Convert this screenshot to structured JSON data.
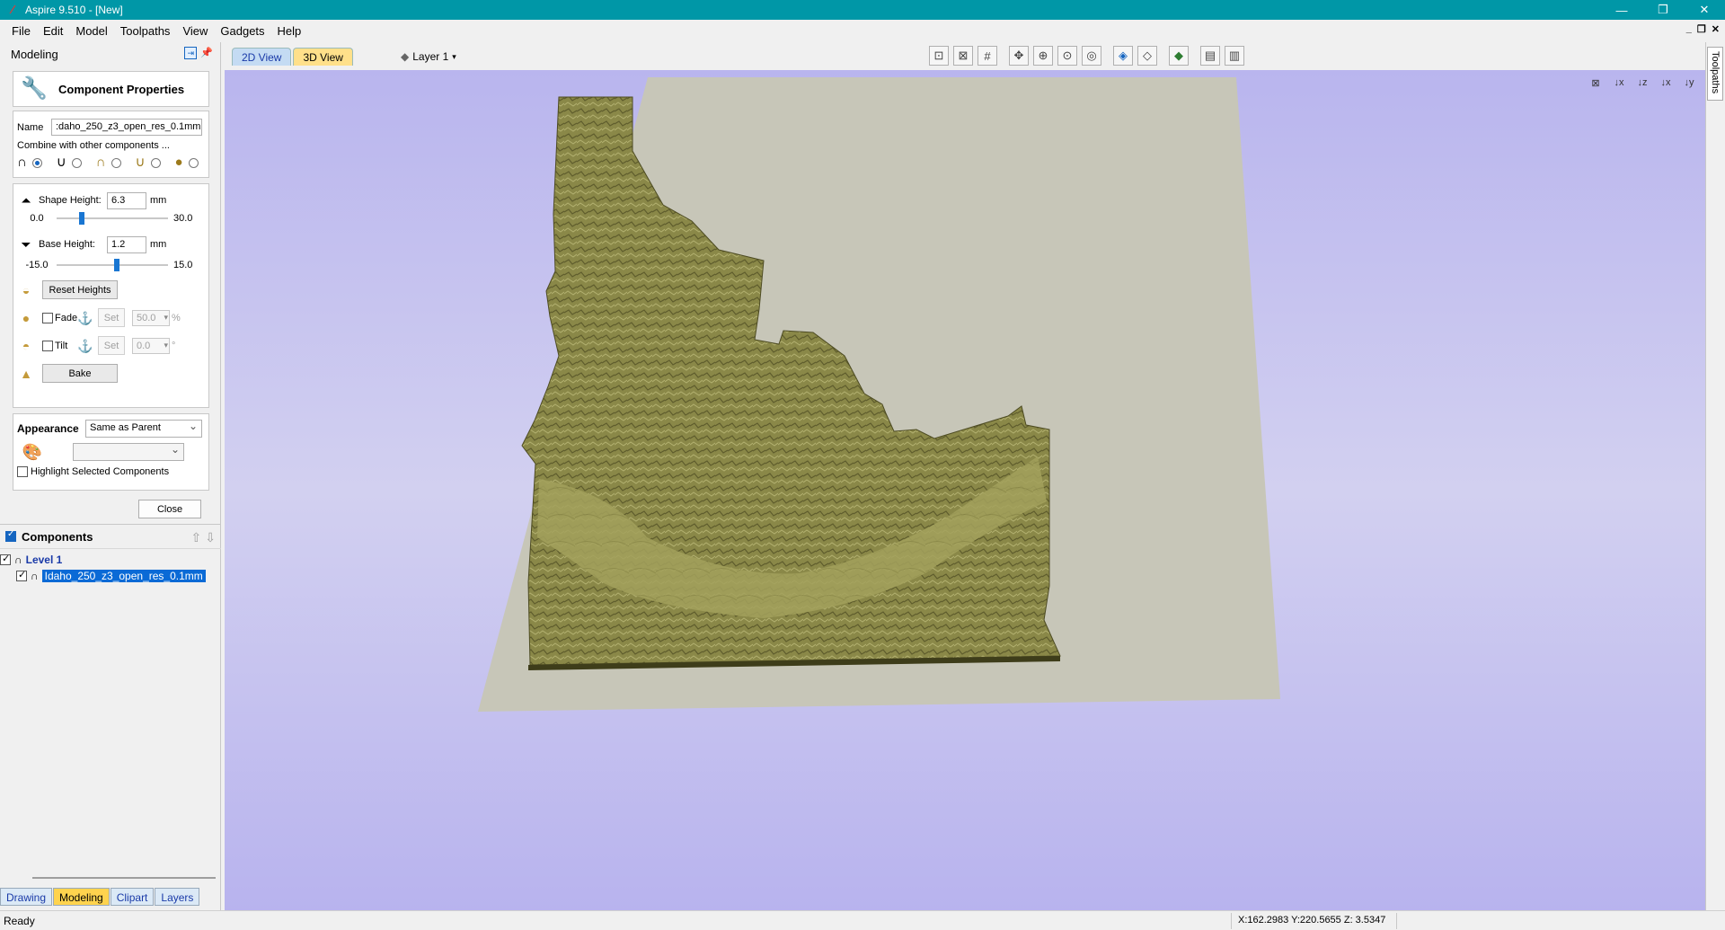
{
  "window": {
    "title": "Aspire 9.510 - [New]"
  },
  "menu": [
    "File",
    "Edit",
    "Model",
    "Toolpaths",
    "View",
    "Gadgets",
    "Help"
  ],
  "panel": {
    "title": "Modeling",
    "component_properties": "Component Properties",
    "name_label": "Name",
    "name_value": ":daho_250_z3_open_res_0.1mm",
    "combine_label": "Combine with other components ...",
    "shape_height_label": "Shape Height:",
    "shape_height_value": "6.3",
    "shape_height_unit": "mm",
    "shape_min": "0.0",
    "shape_max": "30.0",
    "shape_level": 0.21,
    "base_height_label": "Base Height:",
    "base_height_value": "1.2",
    "base_height_unit": "mm",
    "base_min": "-15.0",
    "base_max": "15.0",
    "base_level": 0.54,
    "reset_heights": "Reset Heights",
    "fade_label": "Fade",
    "fade_set": "Set",
    "fade_value": "50.0",
    "fade_unit": "%",
    "tilt_label": "Tilt",
    "tilt_set": "Set",
    "tilt_value": "0.0",
    "tilt_unit": "°",
    "bake": "Bake",
    "appearance_label": "Appearance",
    "appearance_value": "Same as Parent",
    "highlight_label": "Highlight Selected Components",
    "close": "Close"
  },
  "components": {
    "title": "Components",
    "level": "Level 1",
    "item": "Idaho_250_z3_open_res_0.1mm"
  },
  "bottom_tabs": [
    "Drawing",
    "Modeling",
    "Clipart",
    "Layers"
  ],
  "view_tabs": [
    "2D View",
    "3D View"
  ],
  "layer": "Layer 1",
  "right_tab": "Toolpaths",
  "status": {
    "ready": "Ready",
    "coords": "X:162.2983 Y:220.5655 Z:  3.5347"
  },
  "colors": {
    "titlebar": "#0097a7",
    "terrain": "#8a8848",
    "plane": "#c7c6b8"
  }
}
